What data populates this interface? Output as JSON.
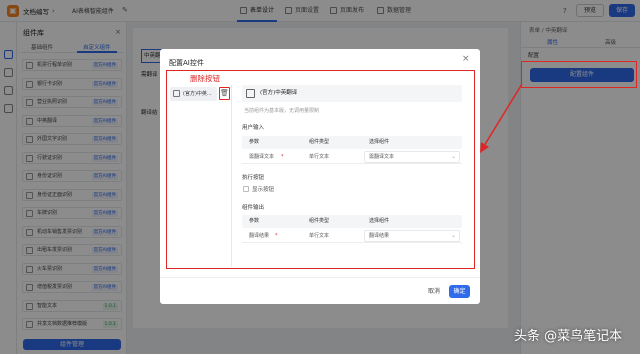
{
  "topbar": {
    "app_name": "文档编写",
    "page_name": "AI表格智能组件",
    "tabs": [
      "表单设计",
      "页面设置",
      "页面发布",
      "数据管理"
    ],
    "right_btn1": "预览",
    "right_btn2": "保存"
  },
  "left_panel": {
    "title": "组件库",
    "subtabs": [
      "基础组件",
      "自定义组件"
    ],
    "items": [
      {
        "label": "机票行程单识别",
        "tag": "官方AI组件"
      },
      {
        "label": "银行卡识别",
        "tag": "官方AI组件"
      },
      {
        "label": "营业执照识别",
        "tag": "官方AI组件"
      },
      {
        "label": "中英翻译",
        "tag": "官方AI组件"
      },
      {
        "label": "外国文字识别",
        "tag": "官方AI组件"
      },
      {
        "label": "行驶证识别",
        "tag": "官方AI组件"
      },
      {
        "label": "身份证识别",
        "tag": "官方AI组件"
      },
      {
        "label": "身份证正面识别",
        "tag": "官方AI组件"
      },
      {
        "label": "车牌识别",
        "tag": "官方AI组件"
      },
      {
        "label": "机动车销售发票识别",
        "tag": "官方AI组件"
      },
      {
        "label": "出租车发票识别",
        "tag": "官方AI组件"
      },
      {
        "label": "火车票识别",
        "tag": "官方AI组件"
      },
      {
        "label": "增值税发票识别",
        "tag": "官方AI组件"
      },
      {
        "label": "智能文本",
        "tag": "1.0.1"
      },
      {
        "label": "共享文档数据推荐模版",
        "tag": "1.0.1"
      }
    ],
    "manage_btn": "组件管理"
  },
  "canvas": {
    "text1": "中英翻",
    "text2": "需翻译",
    "text3": "翻译结",
    "toolbar_btns": [
      "中英翻译",
      "通用",
      "属性"
    ]
  },
  "right_panel": {
    "breadcrumb": "表单  /  中英翻译",
    "tabs": [
      "属性",
      "高级"
    ],
    "section": "配置",
    "config_btn": "配置组件"
  },
  "modal": {
    "title": "配置AI控件",
    "close": "×",
    "annotation": "删除按钮",
    "list_item": "(官方)中英...",
    "component_name": "(官方)中英翻译",
    "hint": "当前组件为基本版，无调用量限制",
    "input_section": "用户输入",
    "input_headers": [
      "参数",
      "组件类型",
      "选择组件"
    ],
    "input_row": {
      "param": "需翻译文本",
      "required": "*",
      "type": "单行文本",
      "select": "需翻译文本"
    },
    "exec_section": "执行按钮",
    "exec_checkbox": "显示按钮",
    "output_section": "组件输出",
    "output_headers": [
      "参数",
      "组件类型",
      "选择组件"
    ],
    "output_row": {
      "param": "翻译结果",
      "required": "*",
      "type": "单行文本",
      "select": "翻译结果"
    },
    "cancel": "取消",
    "ok": "确定"
  },
  "watermark": "头条 @菜鸟笔记本",
  "colors": {
    "accent": "#2f6bea",
    "annotation": "#e02525",
    "brand": "#f5821f"
  }
}
